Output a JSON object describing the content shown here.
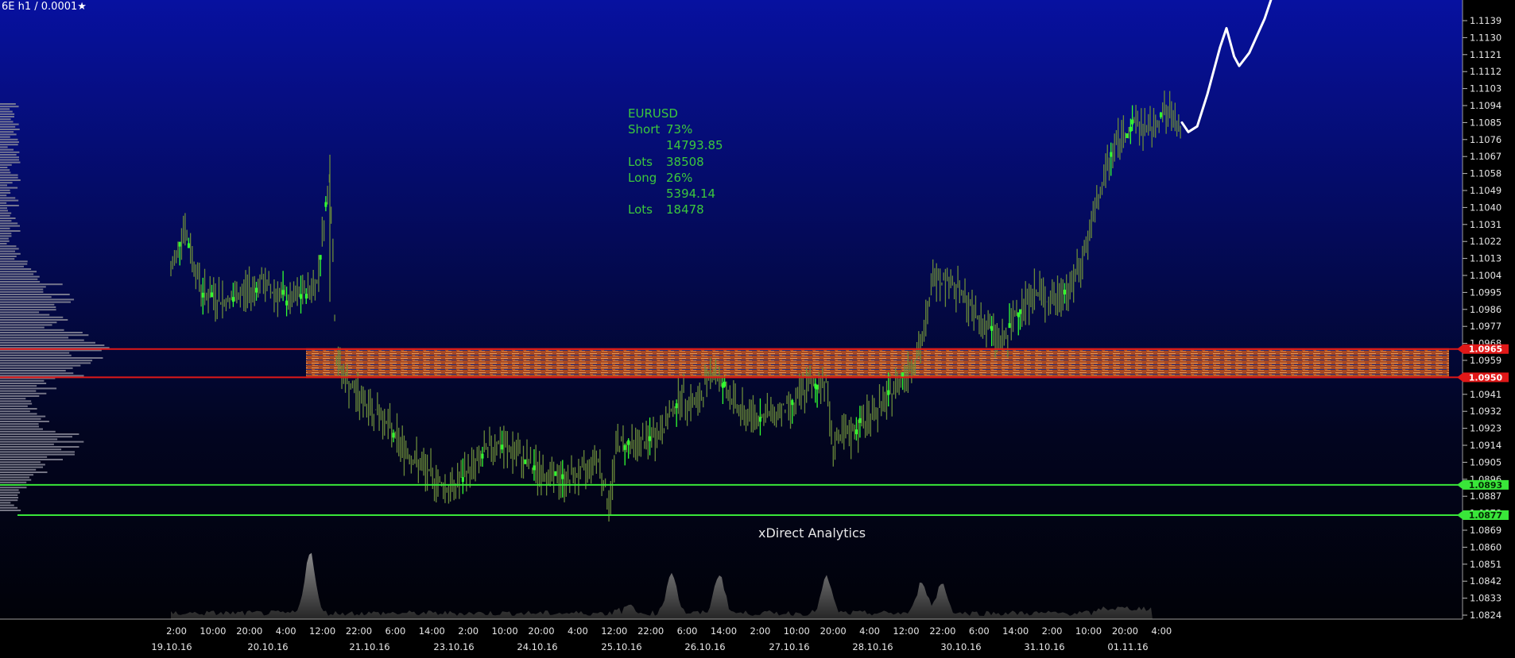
{
  "header": {
    "instrument": "6E h1 / 0.0001",
    "favorite_icon": "star-icon"
  },
  "stats": {
    "symbol": "EURUSD",
    "short_label": "Short",
    "short_pct": "73%",
    "short_amount": "14793.85",
    "short_lots_label": "Lots",
    "short_lots": "38508",
    "long_label": "Long",
    "long_pct": "26%",
    "long_amount": "5394.14",
    "long_lots_label": "Lots",
    "long_lots": "18478"
  },
  "watermark": "xDirect Analytics",
  "levels": {
    "resistance": [
      {
        "label": "1.0965",
        "value": 1.0965
      },
      {
        "label": "1.0950",
        "value": 1.095
      }
    ],
    "support": [
      {
        "label": "1.0893",
        "value": 1.0893
      },
      {
        "label": "1.0877",
        "value": 1.0877
      }
    ]
  },
  "colors": {
    "resistance": "#e01818",
    "support": "#39e639",
    "candle": "#6a8a3a",
    "candle_hl": "#32ff32",
    "forecast": "#ffffff",
    "zone": "#d86a26"
  },
  "chart_data": {
    "type": "candlestick",
    "y_axis": {
      "ticks": [
        "1.1139",
        "1.1130",
        "1.1121",
        "1.1112",
        "1.1103",
        "1.1094",
        "1.1085",
        "1.1076",
        "1.1067",
        "1.1058",
        "1.1049",
        "1.1040",
        "1.1031",
        "1.1022",
        "1.1013",
        "1.1004",
        "1.0995",
        "1.0986",
        "1.0977",
        "1.0968",
        "1.0959",
        "1.0950",
        "1.0941",
        "1.0932",
        "1.0923",
        "1.0914",
        "1.0905",
        "1.0896",
        "1.0887",
        "1.0878",
        "1.0869",
        "1.0860",
        "1.0851",
        "1.0842",
        "1.0833",
        "1.0824"
      ],
      "range": [
        1.082,
        1.115
      ]
    },
    "x_axis": {
      "time_labels": [
        "2:00",
        "10:00",
        "20:00",
        "4:00",
        "12:00",
        "22:00",
        "6:00",
        "14:00",
        "2:00",
        "10:00",
        "20:00",
        "4:00",
        "12:00",
        "22:00",
        "6:00",
        "14:00",
        "2:00",
        "10:00",
        "20:00",
        "4:00",
        "12:00",
        "22:00",
        "6:00",
        "14:00",
        "2:00",
        "10:00",
        "20:00",
        "4:00"
      ],
      "date_labels": [
        "19.10.16",
        "20.10.16",
        "21.10.16",
        "23.10.16",
        "24.10.16",
        "25.10.16",
        "26.10.16",
        "27.10.16",
        "28.10.16",
        "30.10.16",
        "31.10.16",
        "01.11.16"
      ]
    },
    "series": [
      {
        "name": "price",
        "points": [
          [
            0,
            1.1005
          ],
          [
            10,
            1.103
          ],
          [
            25,
            1.0995
          ],
          [
            45,
            1.099
          ],
          [
            70,
            1.1
          ],
          [
            95,
            1.099
          ],
          [
            115,
            1.1
          ],
          [
            125,
            1.106
          ],
          [
            130,
            1.096
          ],
          [
            140,
            1.0945
          ],
          [
            155,
            1.0935
          ],
          [
            165,
            1.093
          ],
          [
            180,
            1.0915
          ],
          [
            200,
            1.09
          ],
          [
            220,
            1.089
          ],
          [
            240,
            1.0905
          ],
          [
            255,
            1.0915
          ],
          [
            270,
            1.091
          ],
          [
            290,
            1.09
          ],
          [
            310,
            1.0895
          ],
          [
            325,
            1.09
          ],
          [
            335,
            1.091
          ],
          [
            345,
            1.088
          ],
          [
            350,
            1.0915
          ],
          [
            370,
            1.0915
          ],
          [
            385,
            1.092
          ],
          [
            400,
            1.094
          ],
          [
            415,
            1.0935
          ],
          [
            425,
            1.0955
          ],
          [
            435,
            1.0945
          ],
          [
            450,
            1.093
          ],
          [
            470,
            1.093
          ],
          [
            490,
            1.0935
          ],
          [
            500,
            1.0945
          ],
          [
            510,
            1.0945
          ],
          [
            515,
            1.095
          ],
          [
            520,
            1.0915
          ],
          [
            535,
            1.092
          ],
          [
            550,
            1.093
          ],
          [
            560,
            1.0935
          ],
          [
            570,
            1.0945
          ],
          [
            580,
            1.0955
          ],
          [
            590,
            1.0965
          ],
          [
            600,
            1.1005
          ],
          [
            615,
            1.1
          ],
          [
            630,
            1.0985
          ],
          [
            645,
            1.0975
          ],
          [
            655,
            1.0968
          ],
          [
            665,
            1.0985
          ],
          [
            680,
            1.0995
          ],
          [
            695,
            1.099
          ],
          [
            710,
            1.1
          ],
          [
            720,
            1.102
          ],
          [
            730,
            1.1045
          ],
          [
            740,
            1.107
          ],
          [
            750,
            1.108
          ],
          [
            760,
            1.1085
          ],
          [
            770,
            1.108
          ],
          [
            780,
            1.109
          ],
          [
            795,
            1.1085
          ]
        ]
      },
      {
        "name": "forecast",
        "points": [
          [
            795,
            1.1085
          ],
          [
            800,
            1.108
          ],
          [
            807,
            1.1083
          ],
          [
            815,
            1.11
          ],
          [
            825,
            1.1125
          ],
          [
            830,
            1.1135
          ],
          [
            836,
            1.112
          ],
          [
            840,
            1.1115
          ],
          [
            848,
            1.1122
          ],
          [
            860,
            1.114
          ],
          [
            865,
            1.115
          ]
        ]
      }
    ]
  }
}
